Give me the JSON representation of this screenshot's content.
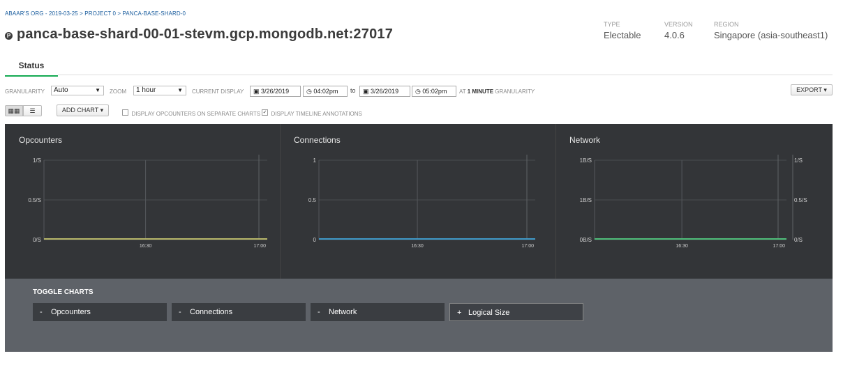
{
  "breadcrumb": "ABAAR'S ORG - 2019-03-25 > PROJECT 0 > PANCA-BASE-SHARD-0",
  "title": "panca-base-shard-00-01-stevm.gcp.mongodb.net:27017",
  "title_icon": "P",
  "meta": {
    "type_label": "TYPE",
    "type_value": "Electable",
    "version_label": "VERSION",
    "version_value": "4.0.6",
    "region_label": "REGION",
    "region_value": "Singapore (asia-southeast1)"
  },
  "tabs": [
    {
      "label": "Status",
      "active": true
    }
  ],
  "controls": {
    "granularity_label": "GRANULARITY",
    "granularity_value": "Auto",
    "zoom_label": "ZOOM",
    "zoom_value": "1 hour",
    "current_display_label": "CURRENT DISPLAY",
    "start_date": "3/26/2019",
    "start_time": "04:02pm",
    "to_label": "to",
    "end_date": "3/26/2019",
    "end_time": "05:02pm",
    "at_label": "AT",
    "granularity_value_text": "1 MINUTE",
    "granularity_suffix": "GRANULARITY",
    "export_label": "EXPORT",
    "add_chart_label": "ADD CHART",
    "separate_charts_label": "DISPLAY OPCOUNTERS ON SEPARATE CHARTS",
    "separate_charts_checked": false,
    "timeline_label": "DISPLAY TIMELINE ANNOTATIONS",
    "timeline_checked": true
  },
  "chart_data": [
    {
      "type": "line",
      "title": "Opcounters",
      "x": [
        "16:30",
        "17:00"
      ],
      "y_ticks": [
        "1/S",
        "0.5/S",
        "0/S"
      ],
      "ylim": [
        0,
        1
      ],
      "series": [
        {
          "values": [
            0,
            0
          ],
          "color": "#b8b86a"
        }
      ],
      "grid": true
    },
    {
      "type": "line",
      "title": "Connections",
      "x": [
        "16:30",
        "17:00"
      ],
      "y_ticks": [
        "1",
        "0.5",
        "0"
      ],
      "ylim": [
        0,
        1
      ],
      "series": [
        {
          "values": [
            0,
            0
          ],
          "color": "#3f9ac9"
        }
      ],
      "grid": true
    },
    {
      "type": "line",
      "title": "Network",
      "x": [
        "16:30",
        "17:00"
      ],
      "y_ticks": [
        "1B/S",
        "1B/S",
        "0B/S"
      ],
      "y2_ticks": [
        "1/S",
        "0.5/S",
        "0/S"
      ],
      "ylim": [
        0,
        1
      ],
      "series": [
        {
          "values": [
            0,
            0
          ],
          "color": "#4fbf7a"
        }
      ],
      "grid": true
    }
  ],
  "toggle": {
    "title": "TOGGLE CHARTS",
    "buttons": [
      {
        "symbol": "-",
        "label": "Opcounters"
      },
      {
        "symbol": "-",
        "label": "Connections"
      },
      {
        "symbol": "-",
        "label": "Network"
      },
      {
        "symbol": "+",
        "label": "Logical Size"
      }
    ]
  },
  "colors": {
    "accent": "#13aa52",
    "chart_bg": "#333538",
    "toggle_bg": "#5e6268"
  }
}
